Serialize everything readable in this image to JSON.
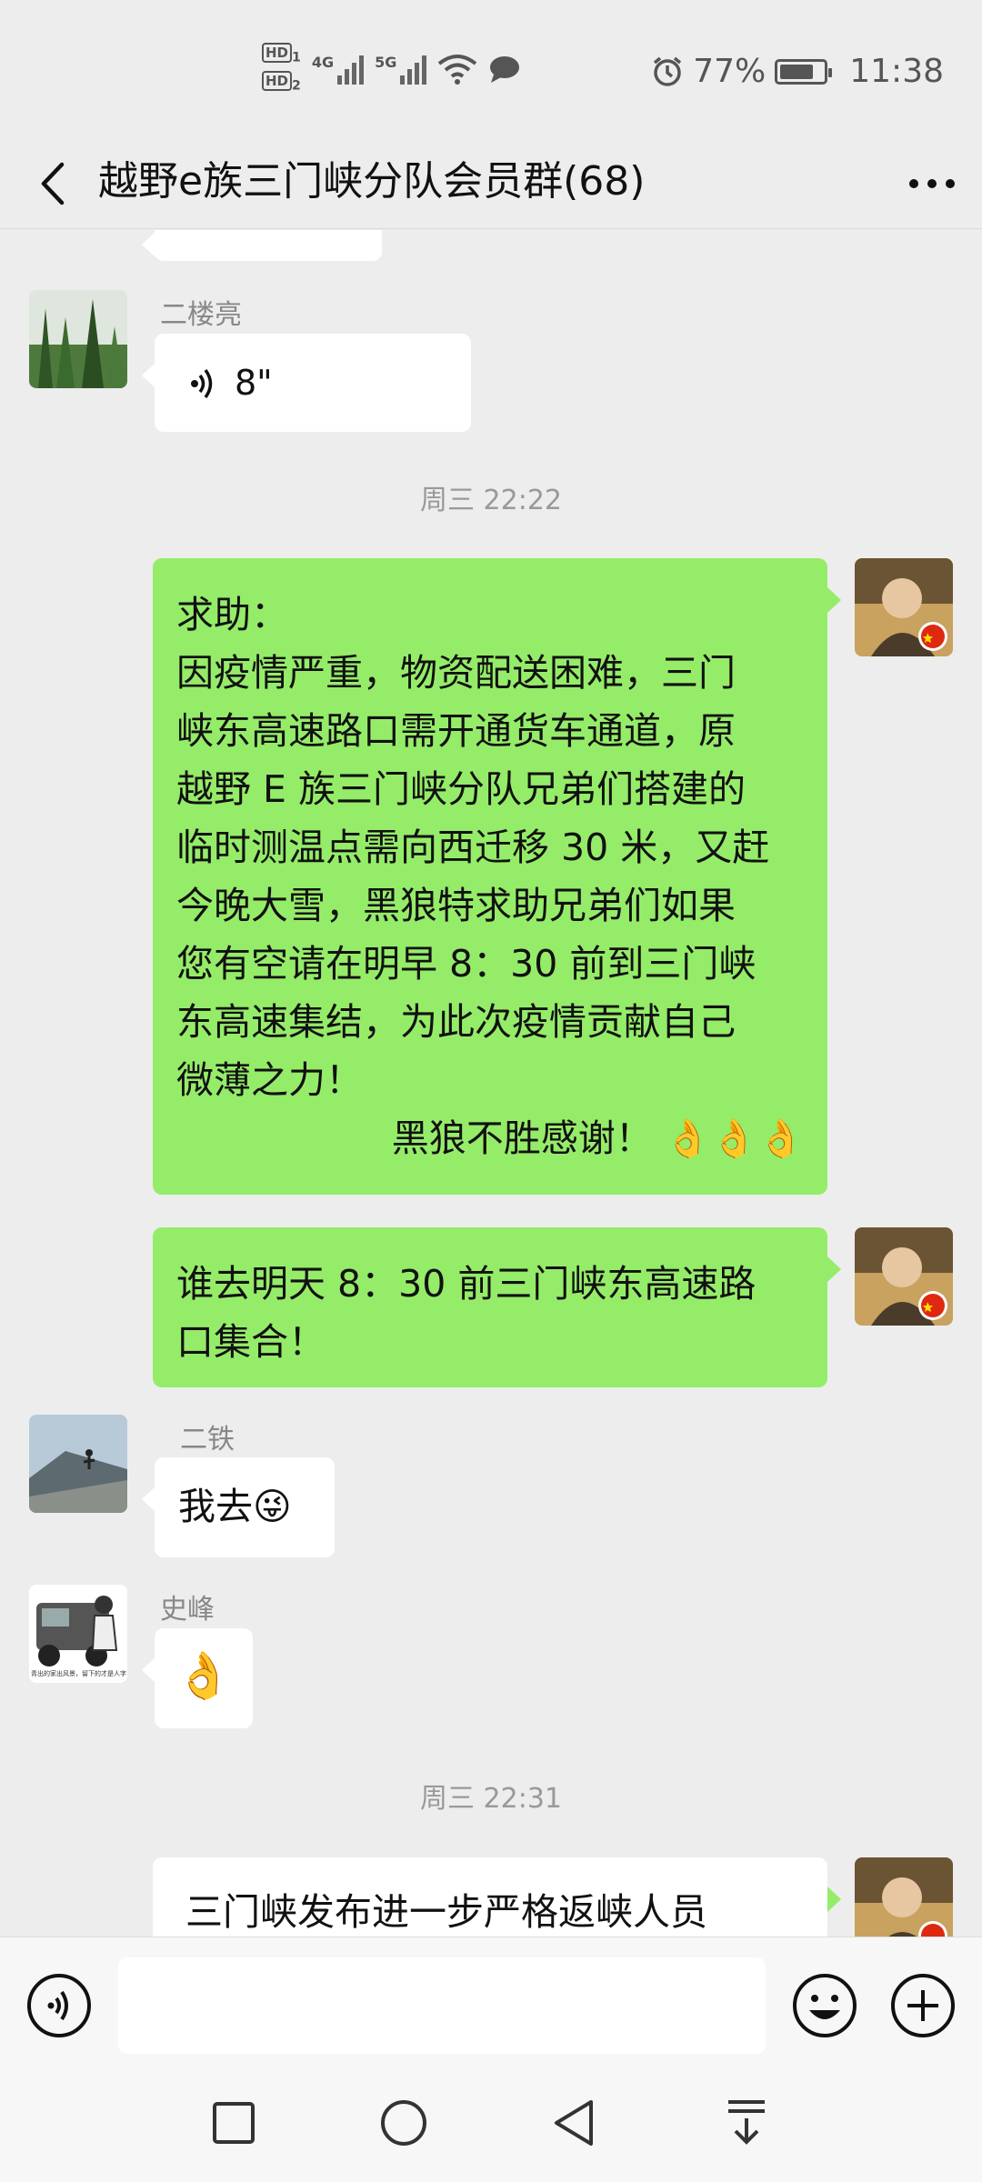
{
  "status_bar": {
    "hd1": "HD",
    "hd1_sub": "1",
    "hd2": "HD",
    "hd2_sub": "2",
    "net1": "4G",
    "net2": "5G",
    "battery_percent": "77%",
    "time": "11:38",
    "icons": [
      "alarm-icon",
      "wifi-icon",
      "message-icon",
      "battery-icon"
    ]
  },
  "header": {
    "title": "越野e族三门峡分队会员群(68)",
    "icons": [
      "back-arrow-icon",
      "more-dots-icon"
    ]
  },
  "messages": [
    {
      "sender": "二楼亮",
      "direction": "in",
      "type": "voice",
      "duration": "8\""
    },
    {
      "type": "timestamp",
      "text": "周三 22:22"
    },
    {
      "direction": "out",
      "type": "text",
      "lines": [
        "求助：",
        "因疫情严重，物资配送困难，三门",
        "峡东高速路口需开通货车通道，原",
        "越野 E 族三门峡分队兄弟们搭建的",
        "临时测温点需向西迁移 30 米，又赶",
        "今晚大雪，黑狼特求助兄弟们如果",
        "您有空请在明早 8：30 前到三门峡",
        "东高速集结，为此次疫情贡献自己",
        "微薄之力！"
      ],
      "signoff": "黑狼不胜感谢！",
      "emoji": "👌👌👌"
    },
    {
      "direction": "out",
      "type": "text",
      "lines": [
        "谁去明天 8：30 前三门峡东高速路",
        "口集合！"
      ]
    },
    {
      "sender": "二铁",
      "direction": "in",
      "type": "text",
      "text": "我去",
      "emoji": "😜"
    },
    {
      "sender": "史峰",
      "direction": "in",
      "type": "emoji",
      "emoji": "👌"
    },
    {
      "type": "timestamp",
      "text": "周三 22:31"
    },
    {
      "direction": "out",
      "type": "text",
      "lines": [
        "三门峡发布进一步严格返峡人员"
      ]
    }
  ],
  "avatar_caption": "青出的家出风景，留下的才是人字",
  "input_bar": {
    "placeholder": "",
    "icons": [
      "voice-input-icon",
      "emoji-icon",
      "add-icon"
    ]
  },
  "nav_bar": {
    "icons": [
      "recent-apps-icon",
      "home-icon",
      "back-icon",
      "notification-pull-icon"
    ]
  }
}
